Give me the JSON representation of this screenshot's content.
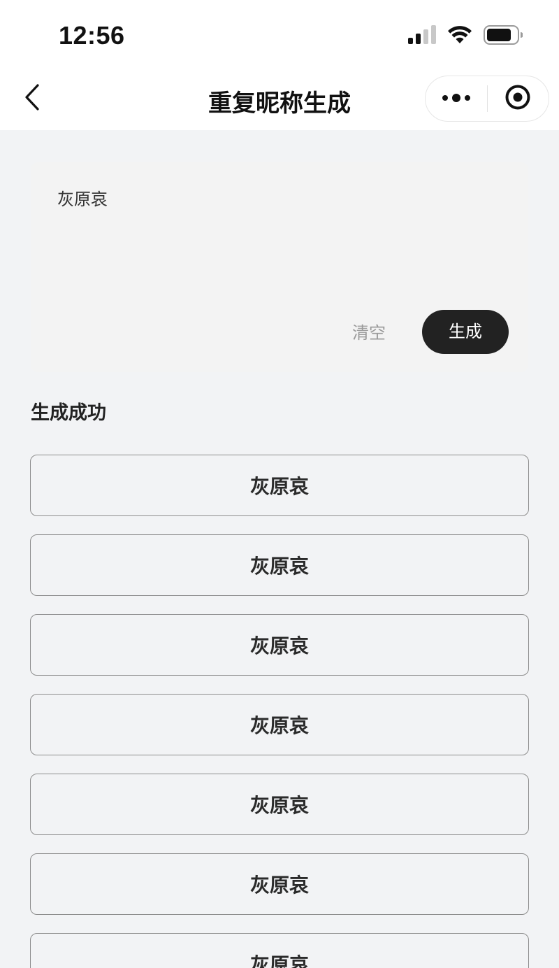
{
  "status_bar": {
    "time": "12:56",
    "icons": [
      "cellular-signal-icon",
      "wifi-icon",
      "battery-icon"
    ]
  },
  "nav": {
    "title": "重复昵称生成",
    "back_icon": "chevron-left-icon",
    "more_icon": "more-dots-icon",
    "close_icon": "target-circle-icon"
  },
  "input": {
    "value": "灰原哀",
    "clear_label": "清空",
    "generate_label": "生成"
  },
  "results": {
    "title": "生成成功",
    "items": [
      "灰原哀",
      "灰原哀",
      "灰原哀",
      "灰原哀",
      "灰原哀",
      "灰原哀",
      "灰原哀"
    ]
  },
  "colors": {
    "background": "#f2f3f5",
    "primary_button": "#222222",
    "secondary_text": "#9a9a9a",
    "item_border": "#8d8d8d"
  }
}
